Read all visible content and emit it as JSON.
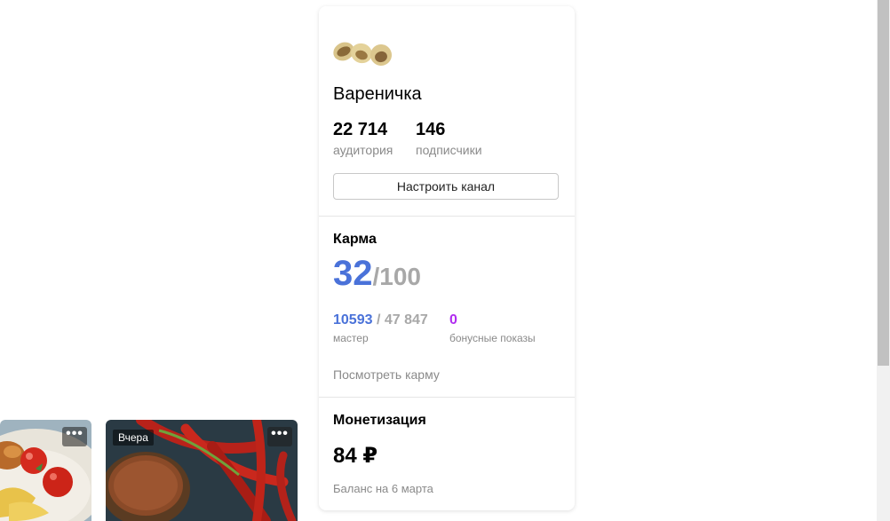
{
  "channel": {
    "name": "Вареничка",
    "audience_value": "22 714",
    "audience_label": "аудитория",
    "subscribers_value": "146",
    "subscribers_label": "подписчики",
    "settings_button": "Настроить канал"
  },
  "karma": {
    "title": "Карма",
    "score": "32",
    "max": "/100",
    "master_value": "10593",
    "master_total": " / 47 847",
    "master_label": "мастер",
    "bonus_value": "0",
    "bonus_label": "бонусные показы",
    "link": "Посмотреть карму"
  },
  "monetization": {
    "title": "Монетизация",
    "balance": "84 ₽",
    "balance_caption": "Баланс на 6 марта"
  },
  "feed": {
    "card1": {
      "more": "•••"
    },
    "card2": {
      "badge": "Вчера",
      "more": "•••"
    }
  },
  "colors": {
    "karma_accent": "#4a72d9",
    "bonus_accent": "#b02cf0",
    "muted": "#8a8a8a"
  }
}
